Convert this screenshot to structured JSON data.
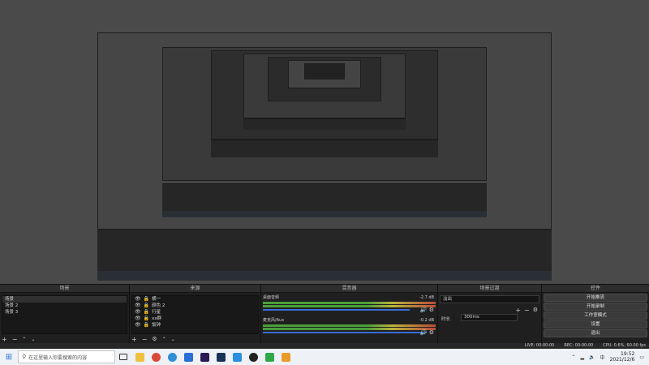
{
  "colors": {
    "accent_blue": "#3b6bd6",
    "meter_green": "#4a9e3a",
    "meter_yellow": "#b8b23a",
    "meter_red": "#b94a3a",
    "taskbar_bg": "#eef1f5"
  },
  "docks": {
    "scenes": {
      "title": "场景",
      "items": [
        "场景",
        "场景 2",
        "场景 3"
      ],
      "selected_index": 0
    },
    "sources": {
      "title": "来源",
      "items": [
        "横一",
        "颜色 2",
        "行星",
        "xx群",
        "饭钟"
      ]
    },
    "mixer": {
      "title": "混音器",
      "tracks": [
        {
          "name": "桌面音频",
          "db": "-2.7 dB",
          "level": 0.85
        },
        {
          "name": "麦克风/Aux",
          "db": "-0.2 dB",
          "level": 0.95
        }
      ]
    },
    "transitions": {
      "title": "场景过渡",
      "selected": "淡出",
      "duration_label": "时长",
      "duration_value": "300ms"
    },
    "controls": {
      "title": "控件",
      "buttons": [
        "开始推流",
        "开始录制",
        "工作室模式",
        "设置",
        "退出"
      ]
    }
  },
  "statusbar": {
    "live": "LIVE: 00:00:00",
    "rec": "REC: 00:00:00",
    "cpu": "CPU: 0.6%, 60.00 fps"
  },
  "taskbar": {
    "search_placeholder": "在这里输入你要搜索的内容",
    "tray_lang": "中",
    "time": "19:52",
    "date": "2021/12/6"
  }
}
